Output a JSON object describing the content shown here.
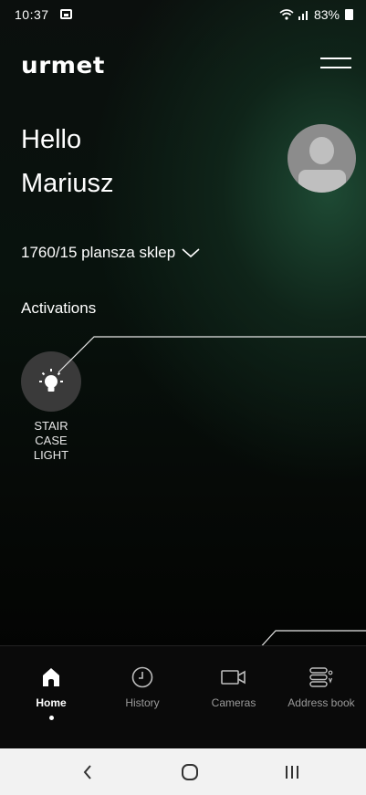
{
  "status_bar": {
    "time": "10:37",
    "battery": "83%"
  },
  "header": {
    "logo": "urmet"
  },
  "greeting": {
    "line1": "Hello",
    "line2": "Mariusz"
  },
  "site": {
    "name": "1760/15 plansza sklep"
  },
  "activations": {
    "title": "Activations",
    "items": [
      {
        "label_lines": [
          "STAIR",
          "CASE",
          "LIGHT"
        ],
        "icon": "lightbulb-icon"
      }
    ]
  },
  "bottom_nav": {
    "items": [
      {
        "label": "Home",
        "icon": "home-icon",
        "active": true
      },
      {
        "label": "History",
        "icon": "clock-icon",
        "active": false
      },
      {
        "label": "Cameras",
        "icon": "camera-icon",
        "active": false
      },
      {
        "label": "Address book",
        "icon": "address-book-icon",
        "active": false
      }
    ]
  },
  "colors": {
    "background_dark": "#050705",
    "accent_glow": "#1e4a34",
    "avatar_grey": "#8c8c8c",
    "activation_circle": "#3a3a3a",
    "system_nav_bg": "#f2f2f2"
  }
}
